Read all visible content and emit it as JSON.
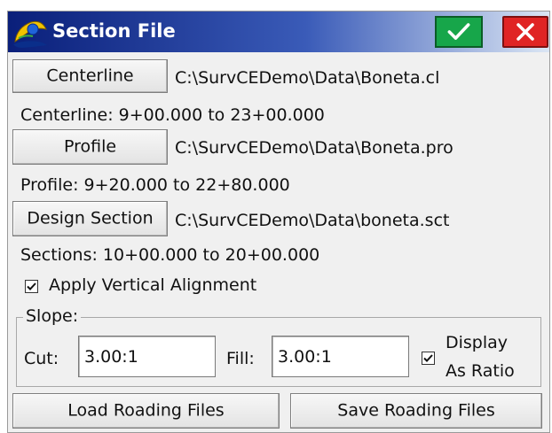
{
  "window": {
    "title": "Section File",
    "ok_icon": "check-icon",
    "close_icon": "close-icon",
    "colors": {
      "title_bar_start": "#0a1f7a",
      "title_bar_end": "#dbe6f4",
      "ok_button": "#17a64a",
      "close_button": "#e02424"
    }
  },
  "centerline": {
    "button_label": "Centerline",
    "path": "C:\\SurvCEDemo\\Data\\Boneta.cl",
    "range": "Centerline: 9+00.000 to 23+00.000"
  },
  "profile": {
    "button_label": "Profile",
    "path": "C:\\SurvCEDemo\\Data\\Boneta.pro",
    "range": "Profile: 9+20.000 to 22+80.000"
  },
  "design_section": {
    "button_label": "Design Section",
    "path": "C:\\SurvCEDemo\\Data\\boneta.sct",
    "range": "Sections: 10+00.000 to 20+00.000"
  },
  "apply_vertical_alignment": {
    "label": "Apply Vertical Alignment",
    "checked": true
  },
  "slope": {
    "group_label": "Slope:",
    "cut_label": "Cut:",
    "cut_value": "3.00:1",
    "fill_label": "Fill:",
    "fill_value": "3.00:1",
    "display_as_ratio": {
      "label_line1": "Display",
      "label_line2": "As Ratio",
      "checked": true
    }
  },
  "footer": {
    "load_label": "Load Roading Files",
    "save_label": "Save Roading Files"
  }
}
